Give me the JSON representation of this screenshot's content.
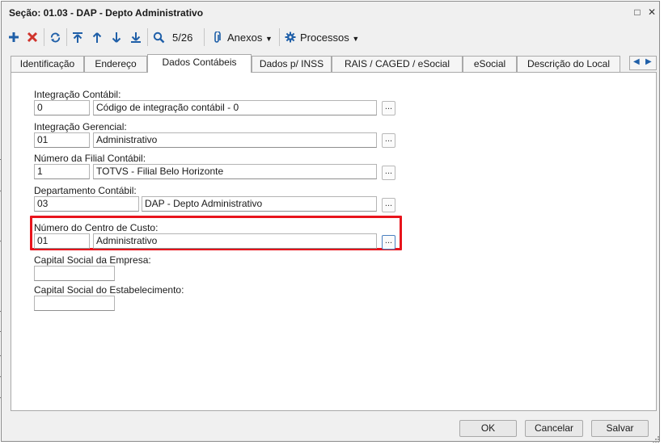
{
  "window": {
    "title": "Seção: 01.03 - DAP - Depto Administrativo",
    "controls": [
      "□",
      "✕"
    ]
  },
  "toolbar": {
    "icons": [
      "add-icon",
      "delete-icon",
      "refresh-icon",
      "first-record-icon",
      "previous-record-icon",
      "next-record-icon",
      "last-record-icon",
      "search-icon",
      "paperclip-icon",
      "gear-icon"
    ],
    "record_position": "5/26",
    "attachments_label": "Anexos",
    "processes_label": "Processos",
    "dropdown_caret": "▼",
    "colors": {
      "icon_blue": "#1f5fa8",
      "delete_red": "#d0342c"
    }
  },
  "tabs": [
    {
      "label": "Identificação",
      "active": false
    },
    {
      "label": "Endereço",
      "active": false
    },
    {
      "label": "Dados Contábeis",
      "active": true
    },
    {
      "label": "Dados p/ INSS",
      "active": false
    },
    {
      "label": "RAIS / CAGED / eSocial",
      "active": false
    },
    {
      "label": "eSocial",
      "active": false
    },
    {
      "label": "Descrição do Local",
      "active": false
    }
  ],
  "tab_nav": {
    "prev": "◀",
    "next": "▶"
  },
  "form": {
    "lookup_button_label": "...",
    "fields": [
      {
        "label": "Integração Contábil:",
        "code": "0",
        "description": "Código de integração contábil - 0"
      },
      {
        "label": "Integração Gerencial:",
        "code": "01",
        "description": "Administrativo"
      },
      {
        "label": "Número da Filial Contábil:",
        "code": "1",
        "description": "TOTVS - Filial Belo Horizonte"
      },
      {
        "label": "Departamento Contábil:",
        "code": "03",
        "description": "DAP - Depto Administrativo"
      },
      {
        "label": "Número do Centro de Custo:",
        "code": "01",
        "description": "Administrativo",
        "highlighted": true
      }
    ],
    "capital_empresa": {
      "label": "Capital Social da Empresa:",
      "value": ""
    },
    "capital_estabelecimento": {
      "label": "Capital Social do Estabelecimento:",
      "value": ""
    },
    "highlight_color": "#e8141c"
  },
  "footer": {
    "ok_label": "OK",
    "cancel_label": "Cancelar",
    "save_label": "Salvar"
  }
}
